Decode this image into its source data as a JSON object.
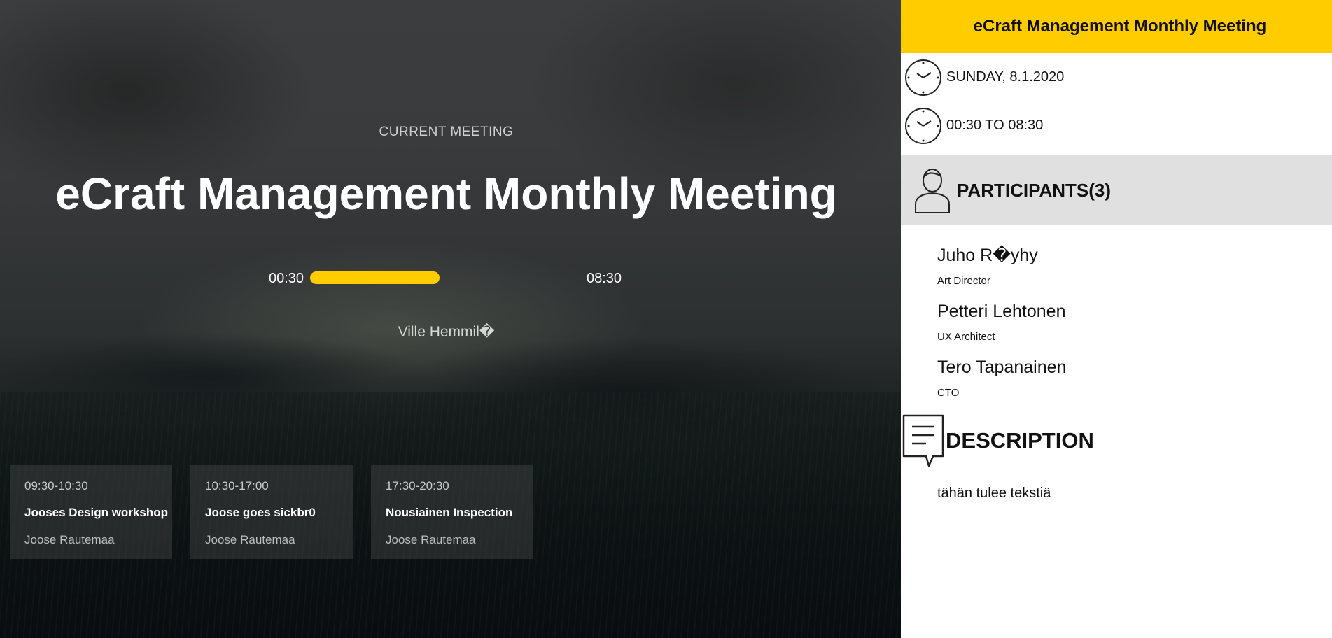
{
  "current_meeting": {
    "label": "CURRENT MEETING",
    "title": "eCraft Management Monthly Meeting",
    "start": "00:30",
    "end": "08:30",
    "progress_fraction": 0.49,
    "organizer": "Ville Hemmil�"
  },
  "upcoming": [
    {
      "time": "09:30-10:30",
      "title": "Jooses Design workshop",
      "owner": "Joose Rautemaa"
    },
    {
      "time": "10:30-17:00",
      "title": "Joose goes sickbr0",
      "owner": "Joose Rautemaa"
    },
    {
      "time": "17:30-20:30",
      "title": "Nousiainen Inspection",
      "owner": "Joose Rautemaa"
    }
  ],
  "sidebar": {
    "title": "eCraft Management Monthly Meeting",
    "date": "SUNDAY, 8.1.2020",
    "time_range": "00:30 TO 08:30",
    "participants_heading": "PARTICIPANTS(3)",
    "participants": [
      {
        "name": "Juho R�yhy",
        "role": "Art Director"
      },
      {
        "name": "Petteri Lehtonen",
        "role": "UX Architect"
      },
      {
        "name": "Tero Tapanainen",
        "role": "CTO"
      }
    ],
    "description_heading": "DESCRIPTION",
    "description": "tähän tulee tekstiä"
  },
  "icons": {
    "date": "clock-icon",
    "time": "clock-icon",
    "participants": "person-icon",
    "description": "speech-bubble-icon"
  },
  "colors": {
    "accent": "#ffcc00",
    "participants_bg": "#e0e0e0"
  }
}
